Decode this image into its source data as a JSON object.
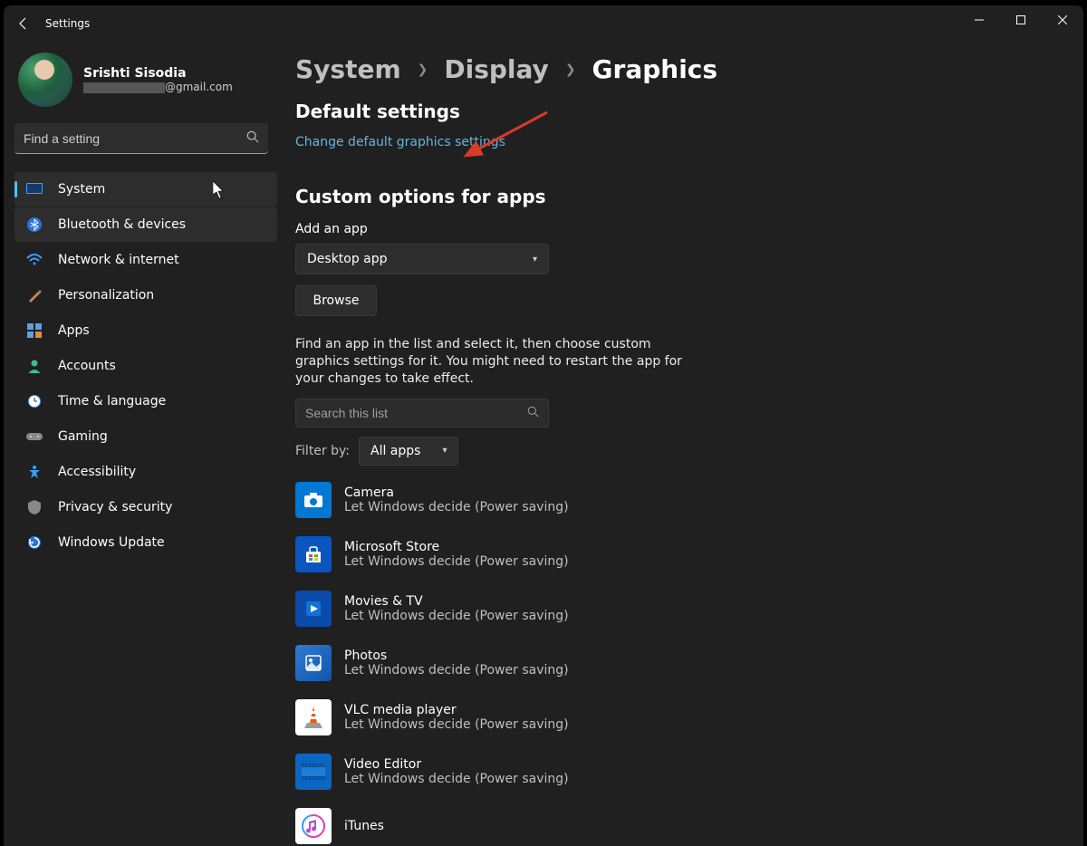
{
  "window": {
    "title": "Settings"
  },
  "user": {
    "name": "Srishti Sisodia",
    "email_suffix": "@gmail.com"
  },
  "search": {
    "placeholder": "Find a setting"
  },
  "nav": [
    {
      "label": "System",
      "key": "system"
    },
    {
      "label": "Bluetooth & devices",
      "key": "bluetooth"
    },
    {
      "label": "Network & internet",
      "key": "network"
    },
    {
      "label": "Personalization",
      "key": "personalization"
    },
    {
      "label": "Apps",
      "key": "apps"
    },
    {
      "label": "Accounts",
      "key": "accounts"
    },
    {
      "label": "Time & language",
      "key": "time"
    },
    {
      "label": "Gaming",
      "key": "gaming"
    },
    {
      "label": "Accessibility",
      "key": "accessibility"
    },
    {
      "label": "Privacy & security",
      "key": "privacy"
    },
    {
      "label": "Windows Update",
      "key": "update"
    }
  ],
  "breadcrumb": {
    "l1": "System",
    "l2": "Display",
    "l3": "Graphics"
  },
  "default_section": {
    "heading": "Default settings",
    "link": "Change default graphics settings"
  },
  "custom_section": {
    "heading": "Custom options for apps",
    "add_label": "Add an app",
    "type_select": "Desktop app",
    "browse": "Browse",
    "description": "Find an app in the list and select it, then choose custom graphics settings for it. You might need to restart the app for your changes to take effect.",
    "list_search_placeholder": "Search this list",
    "filter_label": "Filter by:",
    "filter_value": "All apps"
  },
  "apps": [
    {
      "name": "Camera",
      "sub": "Let Windows decide (Power saving)",
      "color": "#0078d4",
      "glyph": "camera"
    },
    {
      "name": "Microsoft Store",
      "sub": "Let Windows decide (Power saving)",
      "color": "#0a55bf",
      "glyph": "store"
    },
    {
      "name": "Movies & TV",
      "sub": "Let Windows decide (Power saving)",
      "color": "#0a4aa8",
      "glyph": "movies"
    },
    {
      "name": "Photos",
      "sub": "Let Windows decide (Power saving)",
      "color": "#1e64c8",
      "glyph": "photos"
    },
    {
      "name": "VLC media player",
      "sub": "Let Windows decide (Power saving)",
      "color": "#ffffff",
      "glyph": "vlc"
    },
    {
      "name": "Video Editor",
      "sub": "Let Windows decide (Power saving)",
      "color": "#0b66c2",
      "glyph": "video"
    },
    {
      "name": "iTunes",
      "sub": "",
      "color": "#ffffff",
      "glyph": "itunes"
    }
  ]
}
